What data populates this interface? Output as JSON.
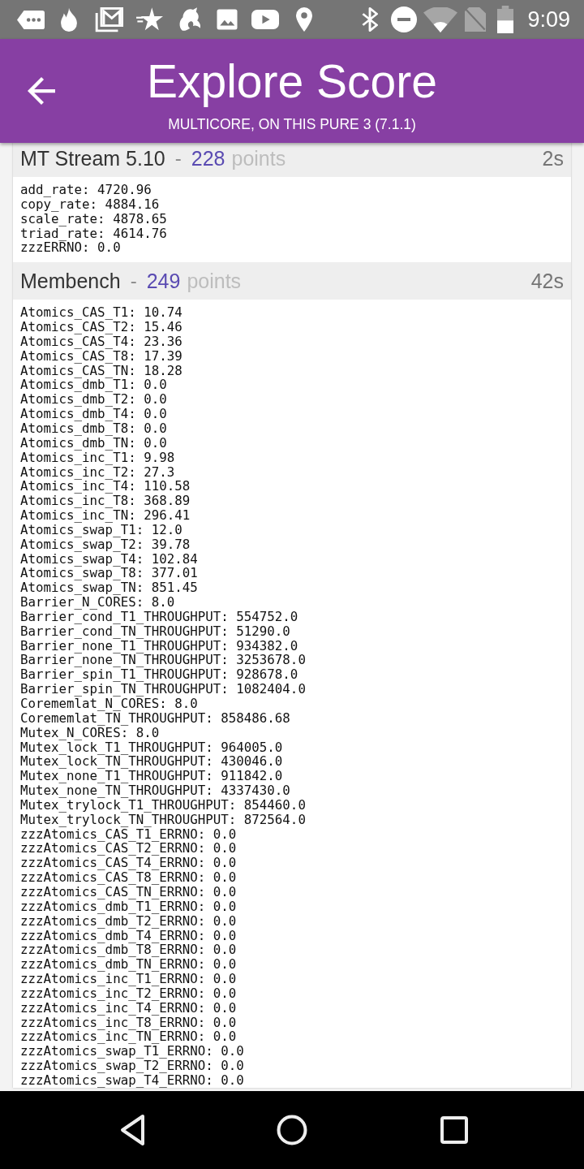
{
  "status_bar": {
    "time": "9:09"
  },
  "app_bar": {
    "title": "Explore Score",
    "subtitle": "MULTICORE, ON THIS PURE 3 (7.1.1)"
  },
  "sections": [
    {
      "name": "MT Stream 5.10",
      "separator": "-",
      "points": "228",
      "points_unit": "points",
      "duration": "2s",
      "results": [
        "add_rate: 4720.96",
        "copy_rate: 4884.16",
        "scale_rate: 4878.65",
        "triad_rate: 4614.76",
        "zzzERRNO: 0.0"
      ]
    },
    {
      "name": "Membench",
      "separator": "-",
      "points": "249",
      "points_unit": "points",
      "duration": "42s",
      "results": [
        "Atomics_CAS_T1: 10.74",
        "Atomics_CAS_T2: 15.46",
        "Atomics_CAS_T4: 23.36",
        "Atomics_CAS_T8: 17.39",
        "Atomics_CAS_TN: 18.28",
        "Atomics_dmb_T1: 0.0",
        "Atomics_dmb_T2: 0.0",
        "Atomics_dmb_T4: 0.0",
        "Atomics_dmb_T8: 0.0",
        "Atomics_dmb_TN: 0.0",
        "Atomics_inc_T1: 9.98",
        "Atomics_inc_T2: 27.3",
        "Atomics_inc_T4: 110.58",
        "Atomics_inc_T8: 368.89",
        "Atomics_inc_TN: 296.41",
        "Atomics_swap_T1: 12.0",
        "Atomics_swap_T2: 39.78",
        "Atomics_swap_T4: 102.84",
        "Atomics_swap_T8: 377.01",
        "Atomics_swap_TN: 851.45",
        "Barrier_N_CORES: 8.0",
        "Barrier_cond_T1_THROUGHPUT: 554752.0",
        "Barrier_cond_TN_THROUGHPUT: 51290.0",
        "Barrier_none_T1_THROUGHPUT: 934382.0",
        "Barrier_none_TN_THROUGHPUT: 3253678.0",
        "Barrier_spin_T1_THROUGHPUT: 928678.0",
        "Barrier_spin_TN_THROUGHPUT: 1082404.0",
        "Corememlat_N_CORES: 8.0",
        "Corememlat_TN_THROUGHPUT: 858486.68",
        "Mutex_N_CORES: 8.0",
        "Mutex_lock_T1_THROUGHPUT: 964005.0",
        "Mutex_lock_TN_THROUGHPUT: 430046.0",
        "Mutex_none_T1_THROUGHPUT: 911842.0",
        "Mutex_none_TN_THROUGHPUT: 4337430.0",
        "Mutex_trylock_T1_THROUGHPUT: 854460.0",
        "Mutex_trylock_TN_THROUGHPUT: 872564.0",
        "zzzAtomics_CAS_T1_ERRNO: 0.0",
        "zzzAtomics_CAS_T2_ERRNO: 0.0",
        "zzzAtomics_CAS_T4_ERRNO: 0.0",
        "zzzAtomics_CAS_T8_ERRNO: 0.0",
        "zzzAtomics_CAS_TN_ERRNO: 0.0",
        "zzzAtomics_dmb_T1_ERRNO: 0.0",
        "zzzAtomics_dmb_T2_ERRNO: 0.0",
        "zzzAtomics_dmb_T4_ERRNO: 0.0",
        "zzzAtomics_dmb_T8_ERRNO: 0.0",
        "zzzAtomics_dmb_TN_ERRNO: 0.0",
        "zzzAtomics_inc_T1_ERRNO: 0.0",
        "zzzAtomics_inc_T2_ERRNO: 0.0",
        "zzzAtomics_inc_T4_ERRNO: 0.0",
        "zzzAtomics_inc_T8_ERRNO: 0.0",
        "zzzAtomics_inc_TN_ERRNO: 0.0",
        "zzzAtomics_swap_T1_ERRNO: 0.0",
        "zzzAtomics_swap_T2_ERRNO: 0.0",
        "zzzAtomics_swap_T4_ERRNO: 0.0"
      ]
    }
  ]
}
